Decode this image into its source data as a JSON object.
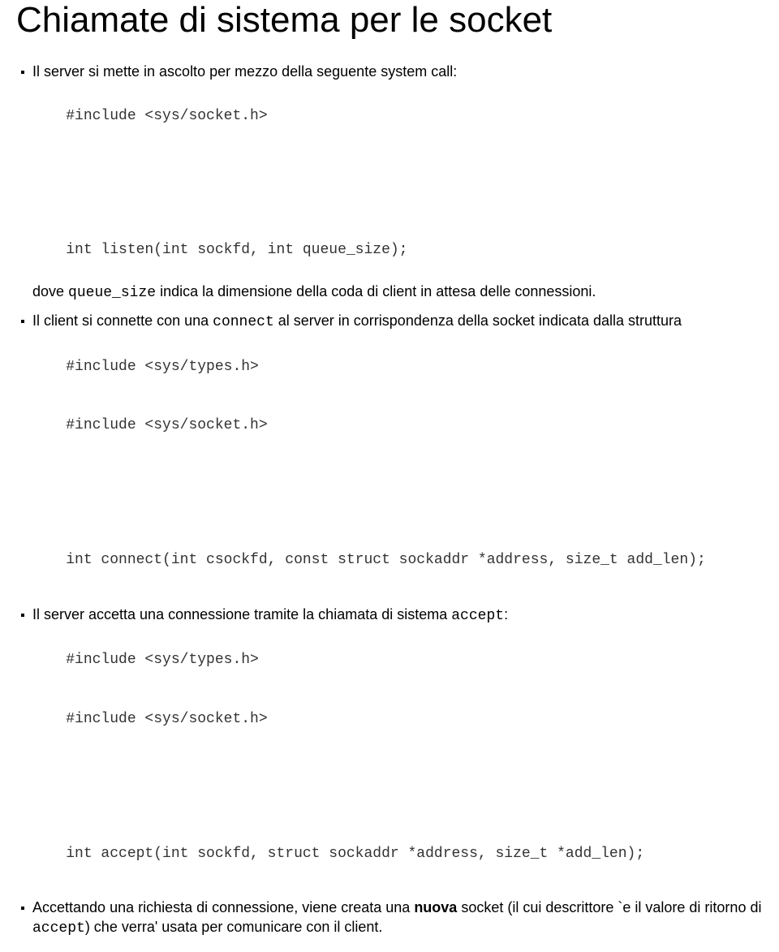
{
  "title": "Chiamate di sistema per le socket",
  "b1_pre": "Il server si mette in ascolto per mezzo della seguente system call:",
  "code1a": "#include <sys/socket.h>",
  "code1b": "int listen(int sockfd, int queue_size);",
  "b1_post_a": "dove ",
  "b1_post_code": "queue_size",
  "b1_post_b": " indica la dimensione della coda di client in attesa delle connessioni.",
  "b2_a": "Il client si connette con una ",
  "b2_code": "connect",
  "b2_b": " al server in corrispondenza della socket indicata dalla struttura",
  "code2a": "#include <sys/types.h>",
  "code2b": "#include <sys/socket.h>",
  "code2c": "int connect(int csockfd, const struct sockaddr *address, size_t add_len);",
  "b3_a": "Il server accetta una connessione tramite la chiamata di sistema ",
  "b3_code": "accept",
  "b3_b": ":",
  "code3a": "#include <sys/types.h>",
  "code3b": "#include <sys/socket.h>",
  "code3c": "int accept(int sockfd, struct sockaddr *address, size_t *add_len);",
  "b4_a": "Accettando una richiesta di connessione, viene creata una ",
  "b4_bold": "nuova",
  "b4_b": " socket (il cui descrittore `e il valore di ritorno di ",
  "b4_code": "accept",
  "b4_c": ") che verra' usata per comunicare con il client."
}
